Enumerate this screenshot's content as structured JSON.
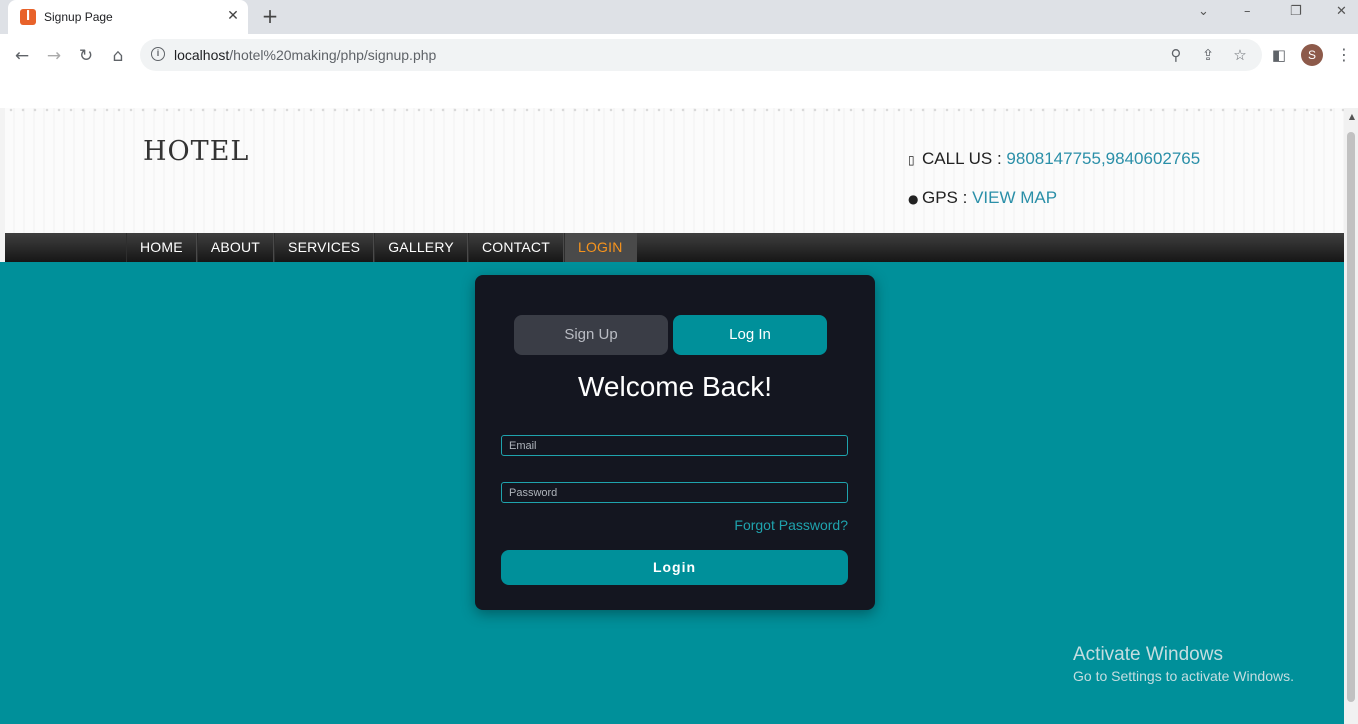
{
  "browser": {
    "tab_title": "Signup Page",
    "tab_close": "✕",
    "new_tab": "+",
    "url_host": "localhost",
    "url_path": "/hotel%20making/php/signup.php",
    "avatar_letter": "S",
    "icons": [
      "back-icon",
      "forward-icon",
      "reload-icon",
      "home-icon",
      "info-icon",
      "zoom-icon",
      "share-icon",
      "bookmark-star-icon",
      "side-panel-icon",
      "menu-dots-icon"
    ]
  },
  "header": {
    "logo": "HOTEL",
    "call_label": "CALL US : ",
    "call_value": "9808147755,9840602765",
    "gps_label": "GPS : ",
    "gps_value": "VIEW MAP"
  },
  "nav": {
    "items": [
      {
        "label": "HOME"
      },
      {
        "label": "ABOUT"
      },
      {
        "label": "SERVICES"
      },
      {
        "label": "GALLERY"
      },
      {
        "label": "CONTACT"
      },
      {
        "label": "LOGIN",
        "active": true
      }
    ]
  },
  "login_card": {
    "tab_signup": "Sign Up",
    "tab_login": "Log In",
    "heading": "Welcome Back!",
    "email_placeholder": "Email",
    "password_placeholder": "Password",
    "forgot": "Forgot Password?",
    "submit": "Login"
  },
  "windows_notice": {
    "title": "Activate Windows",
    "subtitle": "Go to Settings to activate Windows."
  },
  "colors": {
    "teal": "#00909a",
    "card": "#141620",
    "nav_active": "#f7941d",
    "link": "#2a8fa8"
  }
}
